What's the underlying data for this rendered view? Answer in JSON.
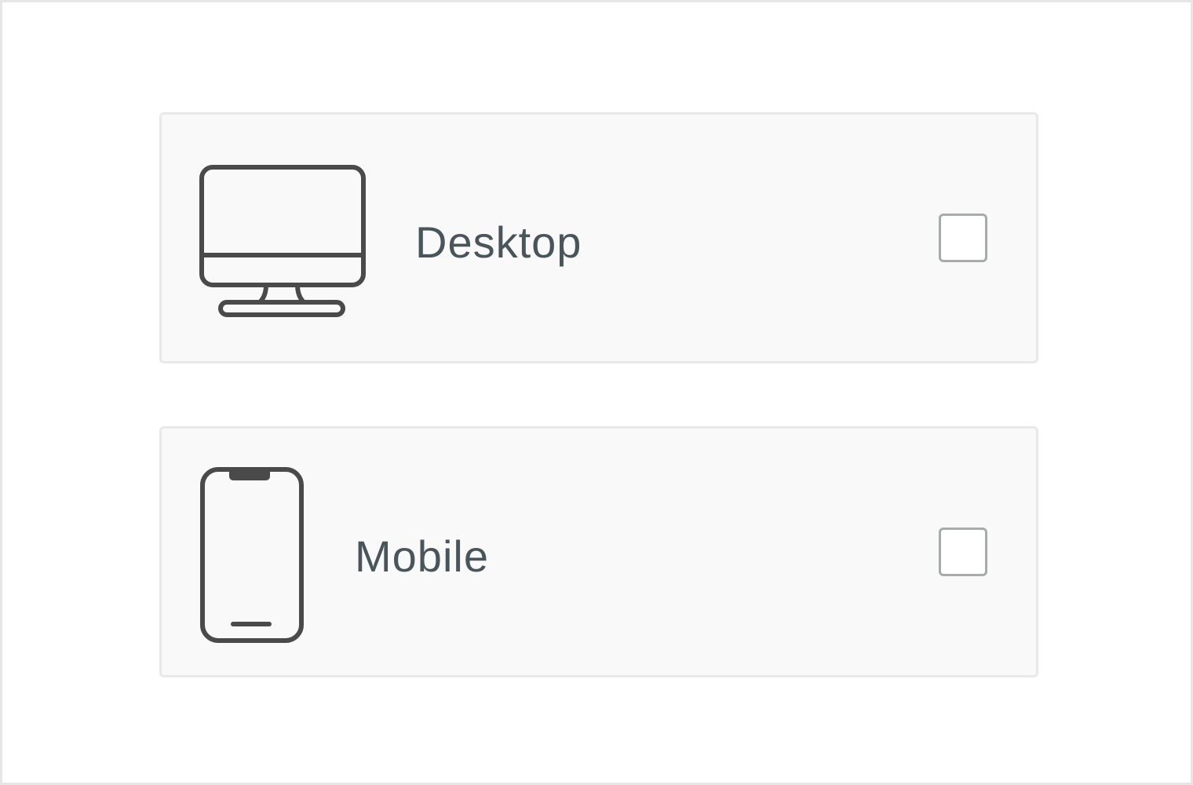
{
  "options": [
    {
      "label": "Desktop",
      "icon": "desktop-monitor-icon",
      "checked": false
    },
    {
      "label": "Mobile",
      "icon": "mobile-phone-icon",
      "checked": false
    }
  ],
  "colors": {
    "label_text": "#48555a",
    "icon_stroke": "#4a4a4a",
    "card_background": "#f9f9f9",
    "card_border": "#e9e9e9",
    "checkbox_border": "#a7abab"
  }
}
